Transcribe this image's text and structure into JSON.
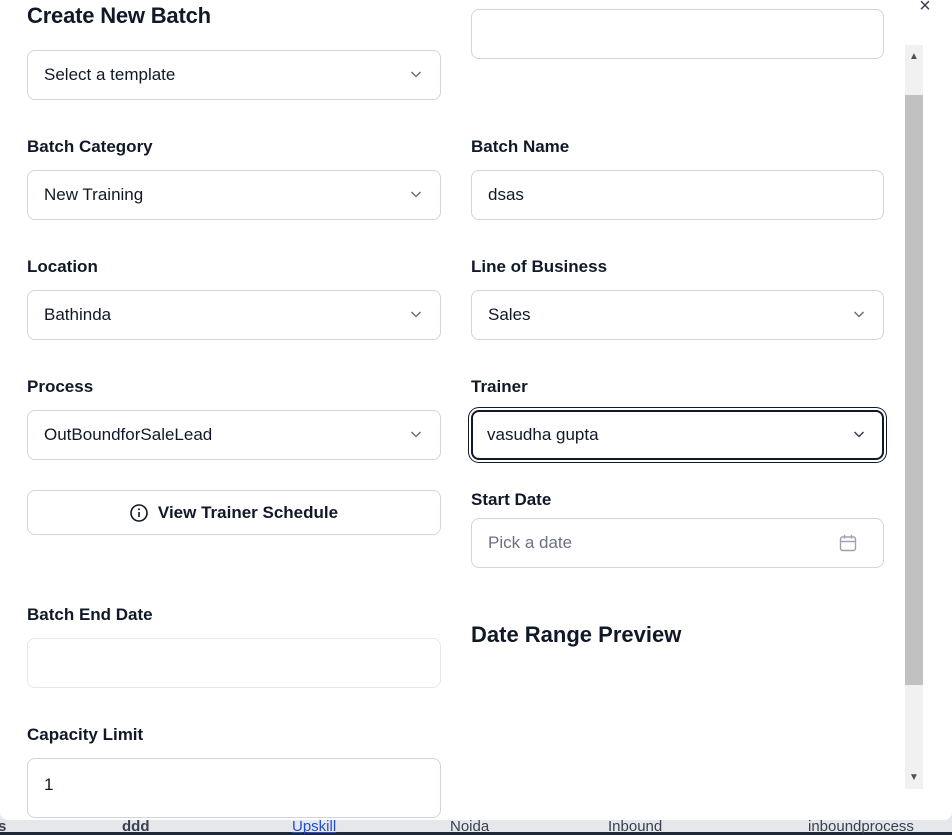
{
  "dialog": {
    "title": "Create New Batch",
    "close_label": "×"
  },
  "template": {
    "value": "Select a template"
  },
  "batch_category": {
    "label": "Batch Category",
    "value": "New Training"
  },
  "batch_name": {
    "label": "Batch Name",
    "value": "dsas"
  },
  "location": {
    "label": "Location",
    "value": "Bathinda"
  },
  "line_of_business": {
    "label": "Line of Business",
    "value": "Sales"
  },
  "process": {
    "label": "Process",
    "value": "OutBoundforSaleLead"
  },
  "trainer": {
    "label": "Trainer",
    "value": "vasudha gupta"
  },
  "view_schedule": {
    "label": "View Trainer Schedule"
  },
  "start_date": {
    "label": "Start Date",
    "placeholder": "Pick a date"
  },
  "batch_end_date": {
    "label": "Batch End Date",
    "value": ""
  },
  "date_range_preview": {
    "title": "Date Range Preview"
  },
  "capacity_limit": {
    "label": "Capacity Limit",
    "value": "1"
  },
  "background_row": {
    "edge": "s",
    "c0": "ddd",
    "c1": "Upskill",
    "c2": "Noida",
    "c3": "Inbound",
    "c4": "inboundprocess"
  },
  "scrollbar": {
    "up": "▲",
    "down": "▼"
  },
  "icons": {
    "chevron": "chevron-down-icon",
    "calendar": "calendar-icon",
    "info": "info-icon",
    "close": "close-icon"
  }
}
